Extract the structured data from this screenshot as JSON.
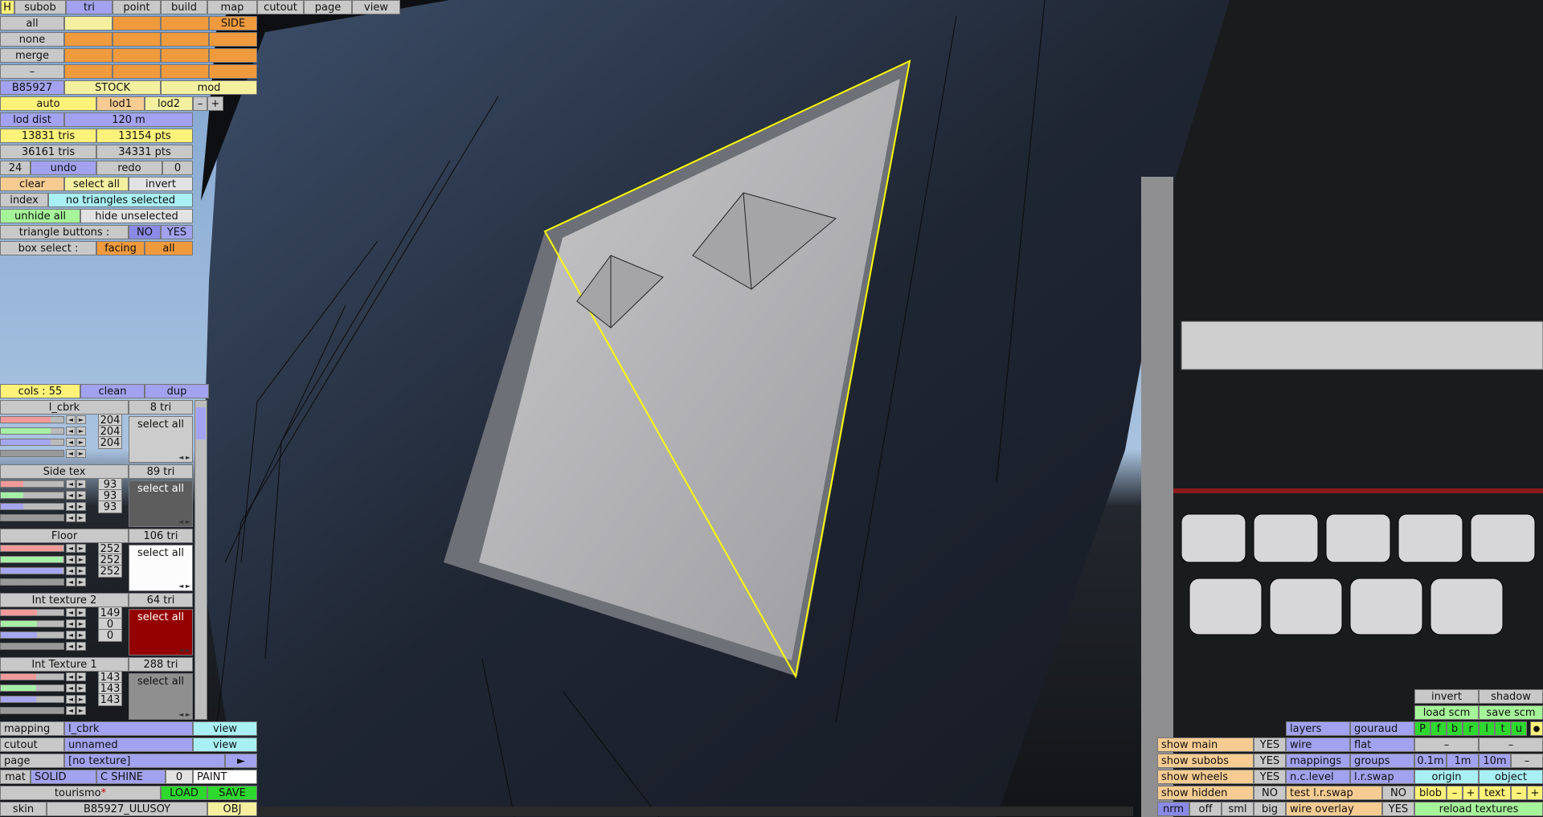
{
  "colors": {
    "accent_yellow": "#ffff00",
    "sky": "#7da7d6",
    "shell": "#1f2633"
  },
  "top_menu": {
    "h": "H",
    "tabs": [
      "subob",
      "tri",
      "point",
      "build",
      "map",
      "cutout",
      "page",
      "view"
    ],
    "active": "tri"
  },
  "lod_grid": {
    "rows": [
      "all",
      "none",
      "merge",
      "–"
    ],
    "side_label": "SIDE",
    "model": "B85927",
    "stock": "STOCK",
    "mod": "mod",
    "auto": "auto",
    "lod1": "lod1",
    "lod2": "lod2",
    "minus": "–",
    "plus": "+"
  },
  "stats": {
    "lod_dist_label": "lod dist",
    "lod_dist_value": "120 m",
    "tris1": "13831 tris",
    "pts1": "13154 pts",
    "tris2": "36161 tris",
    "pts2": "34331 pts",
    "undo_count": "24",
    "undo": "undo",
    "redo": "redo",
    "redo_count": "0",
    "clear": "clear",
    "select_all": "select all",
    "invert": "invert",
    "index": "index",
    "selection_status": "no triangles selected",
    "unhide_all": "unhide all",
    "hide_unselected": "hide unselected",
    "triangle_buttons_label": "triangle buttons :",
    "no": "NO",
    "yes": "YES",
    "box_select_label": "box select :",
    "facing": "facing",
    "all": "all"
  },
  "materials_header": {
    "cols": "cols : 55",
    "clean": "clean",
    "dup": "dup"
  },
  "materials": [
    {
      "name": "l_cbrk",
      "tris": "8 tri",
      "r": "204",
      "g": "204",
      "b": "204",
      "select": "select all",
      "swatch": "#cccccc",
      "text": "#111111",
      "level": 0.8
    },
    {
      "name": "Side tex",
      "tris": "89 tri",
      "r": "93",
      "g": "93",
      "b": "93",
      "select": "select all",
      "swatch": "#5d5d5d",
      "text": "#ffffff",
      "level": 0.36
    },
    {
      "name": "Floor",
      "tris": "106 tri",
      "r": "252",
      "g": "252",
      "b": "252",
      "select": "select all",
      "swatch": "#fcfcfc",
      "text": "#111111",
      "level": 0.99
    },
    {
      "name": "Int texture 2",
      "tris": "64 tri",
      "r": "149",
      "g": "0",
      "b": "0",
      "select": "select all",
      "swatch": "#950000",
      "text": "#ffffff",
      "level": 0.58
    },
    {
      "name": "Int Texture 1",
      "tris": "288 tri",
      "r": "143",
      "g": "143",
      "b": "143",
      "select": "select all",
      "swatch": "#8f8f8f",
      "text": "#111111",
      "level": 0.56
    }
  ],
  "bottom_left": {
    "mapping_label": "mapping",
    "mapping_value": "l_cbrk",
    "view": "view",
    "cutout_label": "cutout",
    "cutout_value": "unnamed",
    "page_label": "page",
    "page_value": "[no texture]",
    "page_arrow": "►",
    "mat_label": "mat",
    "solid": "SOLID",
    "cshine": "C SHINE",
    "cshine_value": "0",
    "paint": "PAINT",
    "tourismo": "tourismo",
    "star": "*",
    "load": "LOAD",
    "save": "SAVE",
    "skin_label": "skin",
    "skin_value": "B85927_ULUSOY",
    "obj": "OBJ"
  },
  "bottom_right": {
    "invert": "invert",
    "shadow": "shadow",
    "load_scm": "load scm",
    "save_scm": "save scm",
    "layers": "layers",
    "gouraud": "gouraud",
    "layer_flags": [
      "P",
      "f",
      "b",
      "r",
      "l",
      "t",
      "u"
    ],
    "dot": "●",
    "wire": "wire",
    "flat": "flat",
    "dash": "–",
    "show_main": "show main",
    "show_main_val": "YES",
    "show_subobs": "show subobs",
    "show_subobs_val": "YES",
    "mappings": "mappings",
    "groups": "groups",
    "grid_01": "0.1m",
    "grid_1": "1m",
    "grid_10": "10m",
    "show_wheels": "show wheels",
    "show_wheels_val": "YES",
    "nc_level": "n.c.level",
    "lr_swap": "l.r.swap",
    "origin": "origin",
    "object": "object",
    "show_hidden": "show hidden",
    "show_hidden_val": "NO",
    "test_lr_swap": "test l.r.swap",
    "test_lr_swap_val": "NO",
    "blob": "blob",
    "minus": "–",
    "plus": "+",
    "text": "text",
    "nrm": "nrm",
    "off": "off",
    "sml": "sml",
    "big": "big",
    "wire_overlay": "wire overlay",
    "wire_overlay_val": "YES",
    "reload_textures": "reload textures"
  }
}
